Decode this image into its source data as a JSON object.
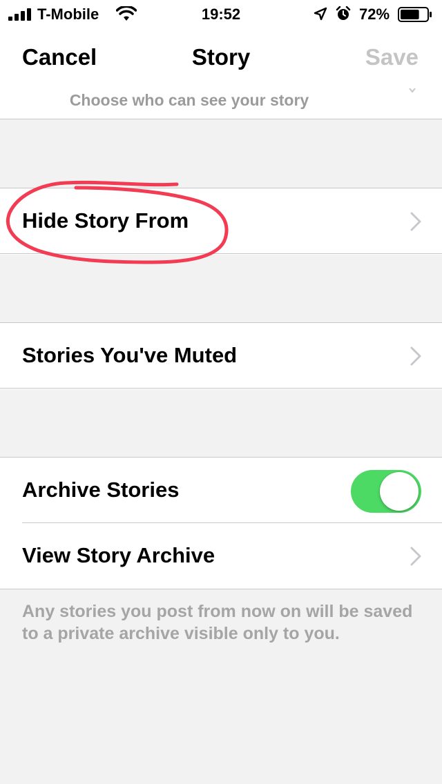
{
  "status_bar": {
    "carrier": "T-Mobile",
    "time": "19:52",
    "battery_percent": "72%",
    "battery_level": 0.72,
    "icons": [
      "signal-icon",
      "wifi-icon",
      "location-icon",
      "alarm-icon",
      "battery-icon"
    ]
  },
  "nav": {
    "cancel_label": "Cancel",
    "title": "Story",
    "save_label": "Save"
  },
  "top_section": {
    "hint": "Choose who can see your story"
  },
  "rows": {
    "hide_story_from": "Hide Story From",
    "stories_muted": "Stories You've Muted",
    "archive_stories": "Archive Stories",
    "view_archive": "View Story Archive"
  },
  "archive_toggle_on": true,
  "footer_note": "Any stories you post from now on will be saved to a private archive visible only to you.",
  "colors": {
    "toggle_on": "#4cd964",
    "annotation": "#f23c54",
    "save_disabled": "#c4c4c4"
  }
}
